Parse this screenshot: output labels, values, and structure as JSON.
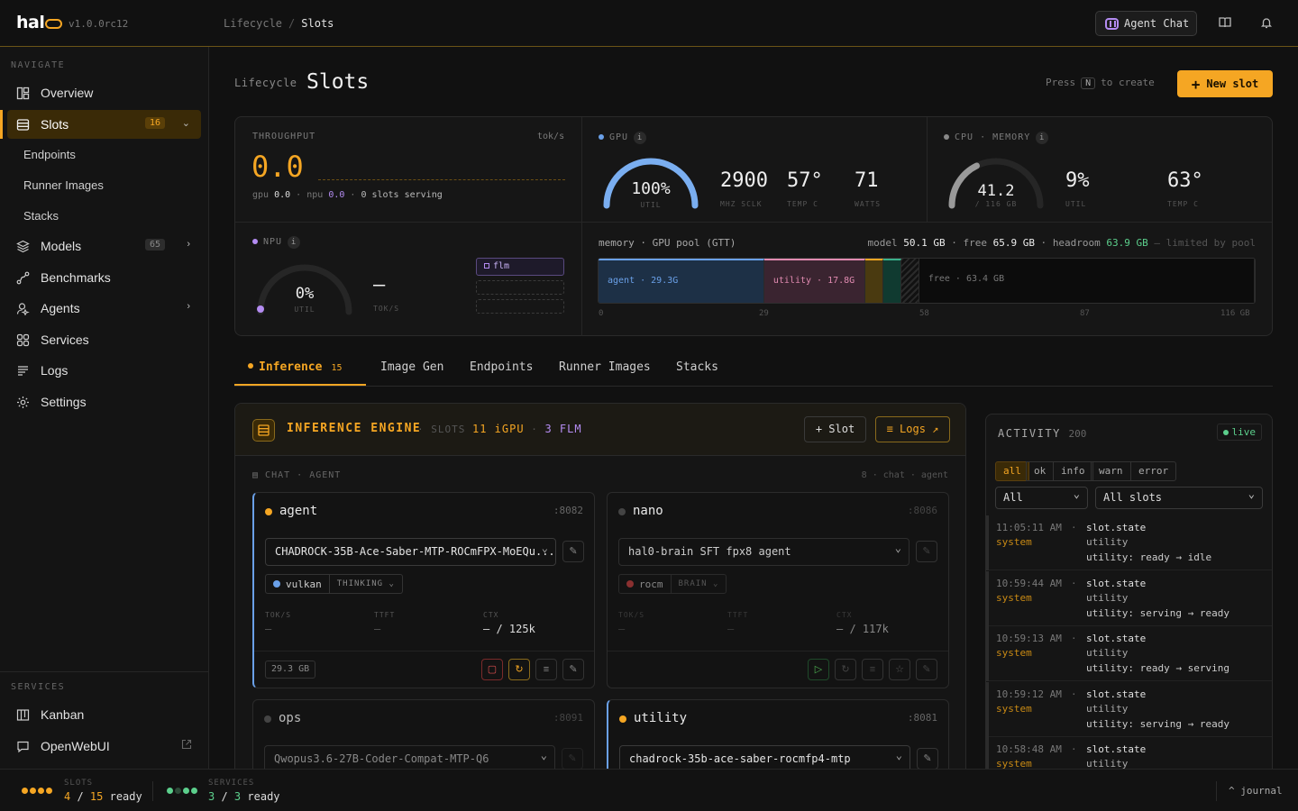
{
  "app": {
    "logo": "hal",
    "version": "v1.0.0rc12"
  },
  "breadcrumb": {
    "parent": "Lifecycle",
    "current": "Slots"
  },
  "header": {
    "agent_chat": "Agent Chat"
  },
  "sidebar": {
    "navigate_title": "NAVIGATE",
    "items": [
      {
        "label": "Overview",
        "icon": "dashboard-icon"
      },
      {
        "label": "Slots",
        "icon": "slots-icon",
        "badge": "16",
        "active": true
      },
      {
        "label": "Models",
        "icon": "layers-icon",
        "badge": "65"
      },
      {
        "label": "Benchmarks",
        "icon": "benchmark-icon"
      },
      {
        "label": "Agents",
        "icon": "agent-icon"
      },
      {
        "label": "Services",
        "icon": "services-icon"
      },
      {
        "label": "Logs",
        "icon": "logs-icon"
      },
      {
        "label": "Settings",
        "icon": "gear-icon"
      }
    ],
    "slots_sub": [
      "Endpoints",
      "Runner Images",
      "Stacks"
    ],
    "services_title": "SERVICES",
    "services": [
      {
        "label": "Kanban",
        "icon": "kanban-icon"
      },
      {
        "label": "OpenWebUI",
        "icon": "chat-icon"
      }
    ]
  },
  "page": {
    "section": "Lifecycle",
    "title": "Slots",
    "press": "Press",
    "key": "N",
    "to_create": "to create",
    "new_slot": "New slot"
  },
  "stats": {
    "throughput": {
      "label": "THROUGHPUT",
      "unit": "tok/s",
      "value": "0.0",
      "gpu_lbl": "gpu",
      "gpu": "0.0",
      "npu_lbl": "npu",
      "npu": "0.0",
      "serving": "0 slots serving"
    },
    "gpu": {
      "label": "GPU",
      "util": "100%",
      "util_lbl": "UTIL",
      "util_frac": 1.0,
      "sclk": "2900",
      "sclk_lbl": "MHZ SCLK",
      "temp": "57°",
      "temp_lbl": "TEMP C",
      "watts": "71",
      "watts_lbl": "WATTS"
    },
    "cpu": {
      "label": "CPU · MEMORY",
      "mem": "41.2",
      "mem_sub": "/ 116 GB",
      "mem_frac": 0.355,
      "util": "9%",
      "util_lbl": "UTIL",
      "temp": "63°",
      "temp_lbl": "TEMP C"
    },
    "npu": {
      "label": "NPU",
      "util": "0%",
      "util_lbl": "UTIL",
      "toks": "–",
      "toks_lbl": "TOK/S",
      "chip": "flm"
    },
    "memory": {
      "title": "memory · GPU pool (GTT)",
      "model_lbl": "model",
      "model": "50.1 GB",
      "free_lbl": "free",
      "free": "65.9 GB",
      "headroom_lbl": "headroom",
      "headroom": "63.9 GB",
      "limited": "— limited by pool",
      "segments": [
        {
          "label": "agent · 29.3G",
          "gb": 29.3,
          "color": "#1d3046",
          "text": "#6aa0e8"
        },
        {
          "label": "utility · 17.8G",
          "gb": 17.8,
          "color": "#3a2430",
          "text": "#e08ab0"
        },
        {
          "label": "",
          "gb": 3.2,
          "color": "#4a3a10",
          "text": "#aaa"
        },
        {
          "label": "",
          "gb": 3.2,
          "color": "#103a30",
          "text": "#aaa"
        },
        {
          "label": "",
          "gb": 3.2,
          "color": "hatch",
          "text": "#aaa"
        },
        {
          "label": "free · 63.4 GB",
          "gb": 59.3,
          "color": "#0c0c0c",
          "text": "#777"
        }
      ],
      "ticks": [
        "0",
        "29",
        "58",
        "87",
        "116 GB"
      ]
    }
  },
  "tabs": [
    {
      "label": "Inference",
      "count": "15",
      "active": true
    },
    {
      "label": "Image Gen"
    },
    {
      "label": "Endpoints"
    },
    {
      "label": "Runner Images"
    },
    {
      "label": "Stacks"
    }
  ],
  "engine": {
    "title": "INFERENCE ENGINE",
    "slots_lbl": "SLOTS",
    "igpu": "11 iGPU",
    "flm": "3 FLM",
    "slot_btn": "Slot",
    "logs_btn": "Logs ↗",
    "group": "CHAT · AGENT",
    "group_meta": "8 · chat · agent",
    "cards": [
      {
        "name": "agent",
        "port": ":8082",
        "model": "CHADROCK-35B-Ace-Saber-MTP-ROCmFPX-MoEQu...",
        "runtime": "vulkan",
        "mode": "THINKING",
        "toks": "–",
        "ttft": "–",
        "ctx": "– / 125k",
        "gb": "29.3 GB",
        "state": "on",
        "dot": "#f5a623",
        "rdot": "#6aa0e8"
      },
      {
        "name": "nano",
        "port": ":8086",
        "model": "hal0-brain SFT fpx8 agent",
        "runtime": "rocm",
        "mode": "BRAIN",
        "toks": "–",
        "ttft": "–",
        "ctx": "– / 117k",
        "state": "off",
        "dot": "#444",
        "rdot": "#b04040"
      },
      {
        "name": "ops",
        "port": ":8091",
        "model": "Qwopus3.6-27B-Coder-Compat-MTP-Q6",
        "state": "off",
        "dot": "#444"
      },
      {
        "name": "utility",
        "port": ":8081",
        "model": "chadrock-35b-ace-saber-rocmfp4-mtp",
        "state": "on",
        "dot": "#f5a623"
      }
    ],
    "metric_labels": {
      "toks": "TOK/S",
      "ttft": "TTFT",
      "ctx": "CTX"
    }
  },
  "activity": {
    "title": "ACTIVITY",
    "count": "200",
    "live": "live",
    "filters": [
      "all",
      "ok",
      "info",
      "warn",
      "error"
    ],
    "level_select": "All",
    "slot_select": "All slots",
    "events": [
      {
        "time": "11:05:11 AM",
        "source": "system",
        "type": "slot.state",
        "slot": "utility",
        "detail": "utility: ready → idle"
      },
      {
        "time": "10:59:44 AM",
        "source": "system",
        "type": "slot.state",
        "slot": "utility",
        "detail": "utility: serving → ready"
      },
      {
        "time": "10:59:13 AM",
        "source": "system",
        "type": "slot.state",
        "slot": "utility",
        "detail": "utility: ready → serving"
      },
      {
        "time": "10:59:12 AM",
        "source": "system",
        "type": "slot.state",
        "slot": "utility",
        "detail": "utility: serving → ready"
      },
      {
        "time": "10:58:48 AM",
        "source": "system",
        "type": "slot.state",
        "slot": "utility",
        "detail": ""
      }
    ]
  },
  "status": {
    "slots_lbl": "SLOTS",
    "slots_ready": "4",
    "slots_total": "15",
    "ready": "ready",
    "services_lbl": "SERVICES",
    "services_ready": "3",
    "services_total": "3",
    "journal": "^ journal"
  }
}
